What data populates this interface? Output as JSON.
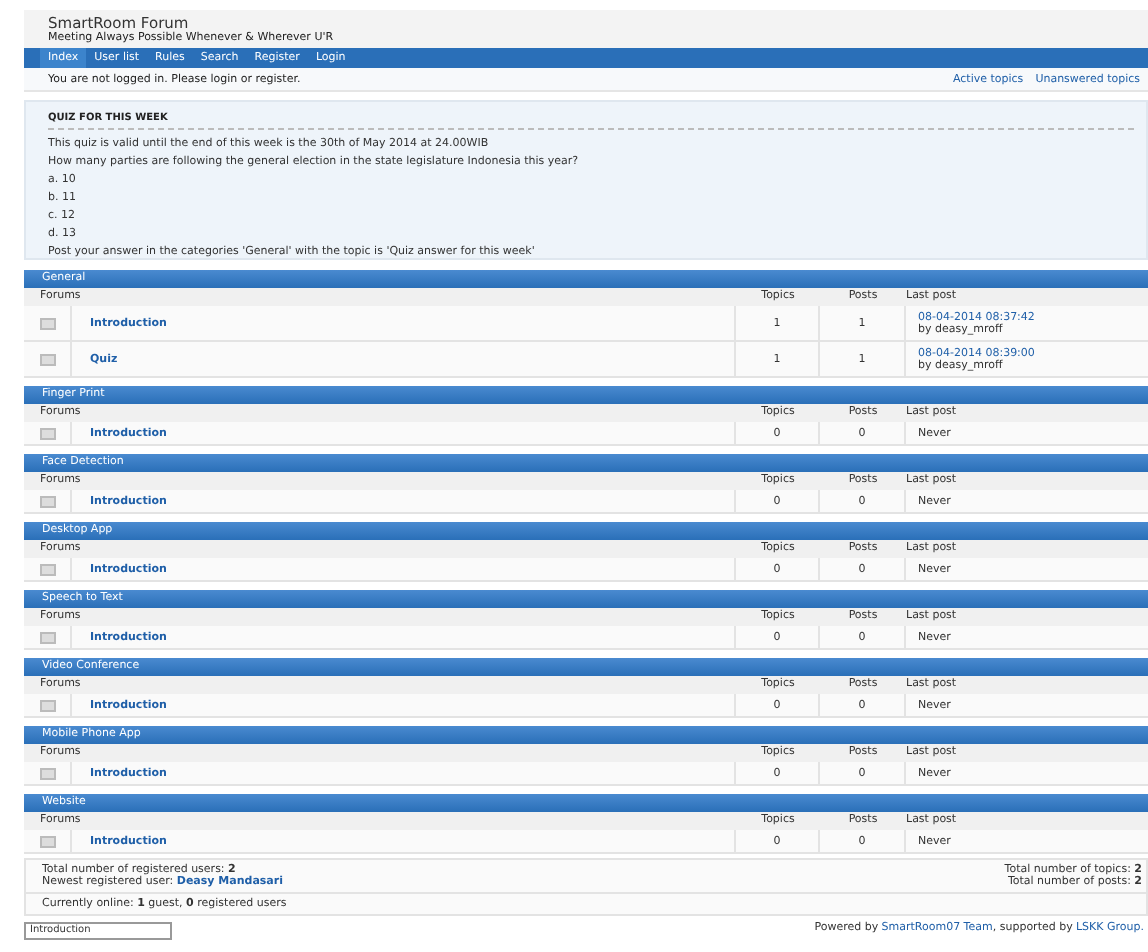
{
  "header": {
    "title": "SmartRoom Forum",
    "subtitle": "Meeting Always Possible Whenever & Wherever U'R"
  },
  "nav": [
    {
      "label": "Index",
      "selected": true
    },
    {
      "label": "User list",
      "selected": false
    },
    {
      "label": "Rules",
      "selected": false
    },
    {
      "label": "Search",
      "selected": false
    },
    {
      "label": "Register",
      "selected": false
    },
    {
      "label": "Login",
      "selected": false
    }
  ],
  "notice": "You are not logged in. Please login or register.",
  "quick_links": [
    "Active topics",
    "Unanswered topics"
  ],
  "quiz": {
    "title": "QUIZ FOR THIS WEEK",
    "lines": [
      "This quiz is valid until the end of this week is the 30th of May 2014 at 24.00WIB",
      "How many parties are following the general election in the state legislature Indonesia this year?",
      "a. 10",
      "b. 11",
      "c. 12",
      "d. 13",
      "Post your answer in the categories 'General' with the topic is 'Quiz answer for this week'"
    ]
  },
  "categories": [
    {
      "name": "General",
      "columns": [
        "Forums",
        "Topics",
        "Posts",
        "Last post"
      ],
      "forums": [
        {
          "name": "Introduction",
          "topics": "1",
          "posts": "1",
          "last_post": {
            "kind": "post",
            "date": "08-04-2014 08:37:42",
            "by": "by deasy_mroff"
          }
        },
        {
          "name": "Quiz",
          "topics": "1",
          "posts": "1",
          "last_post": {
            "kind": "post",
            "date": "08-04-2014 08:39:00",
            "by": "by deasy_mroff"
          }
        }
      ]
    },
    {
      "name": "Finger Print",
      "columns": [
        "Forums",
        "Topics",
        "Posts",
        "Last post"
      ],
      "forums": [
        {
          "name": "Introduction",
          "topics": "0",
          "posts": "0",
          "last_post": {
            "kind": "never",
            "text": "Never"
          }
        }
      ]
    },
    {
      "name": "Face Detection",
      "columns": [
        "Forums",
        "Topics",
        "Posts",
        "Last post"
      ],
      "forums": [
        {
          "name": "Introduction",
          "topics": "0",
          "posts": "0",
          "last_post": {
            "kind": "never",
            "text": "Never"
          }
        }
      ]
    },
    {
      "name": "Desktop App",
      "columns": [
        "Forums",
        "Topics",
        "Posts",
        "Last post"
      ],
      "forums": [
        {
          "name": "Introduction",
          "topics": "0",
          "posts": "0",
          "last_post": {
            "kind": "never",
            "text": "Never"
          }
        }
      ]
    },
    {
      "name": "Speech to Text",
      "columns": [
        "Forums",
        "Topics",
        "Posts",
        "Last post"
      ],
      "forums": [
        {
          "name": "Introduction",
          "topics": "0",
          "posts": "0",
          "last_post": {
            "kind": "never",
            "text": "Never"
          }
        }
      ]
    },
    {
      "name": "Video Conference",
      "columns": [
        "Forums",
        "Topics",
        "Posts",
        "Last post"
      ],
      "forums": [
        {
          "name": "Introduction",
          "topics": "0",
          "posts": "0",
          "last_post": {
            "kind": "never",
            "text": "Never"
          }
        }
      ]
    },
    {
      "name": "Mobile Phone App",
      "columns": [
        "Forums",
        "Topics",
        "Posts",
        "Last post"
      ],
      "forums": [
        {
          "name": "Introduction",
          "topics": "0",
          "posts": "0",
          "last_post": {
            "kind": "never",
            "text": "Never"
          }
        }
      ]
    },
    {
      "name": "Website",
      "columns": [
        "Forums",
        "Topics",
        "Posts",
        "Last post"
      ],
      "forums": [
        {
          "name": "Introduction",
          "topics": "0",
          "posts": "0",
          "last_post": {
            "kind": "never",
            "text": "Never"
          }
        }
      ]
    }
  ],
  "stats": {
    "registered": "Total number of registered users: **2**",
    "newest_label": "Newest registered user:",
    "newest_user": "Deasy Mandasari",
    "topics": "Total number of topics: **2**",
    "posts": "Total number of posts: **2**",
    "online": "Currently online: **1** guest, **0** registered users"
  },
  "jump": {
    "value": "Introduction"
  },
  "powered": [
    {
      "kind": "text",
      "text": "Powered by"
    },
    {
      "kind": "link",
      "text": "SmartRoom07 Team"
    },
    {
      "kind": "text",
      "text": ", supported by"
    },
    {
      "kind": "link",
      "text": "LSKK Group."
    }
  ]
}
